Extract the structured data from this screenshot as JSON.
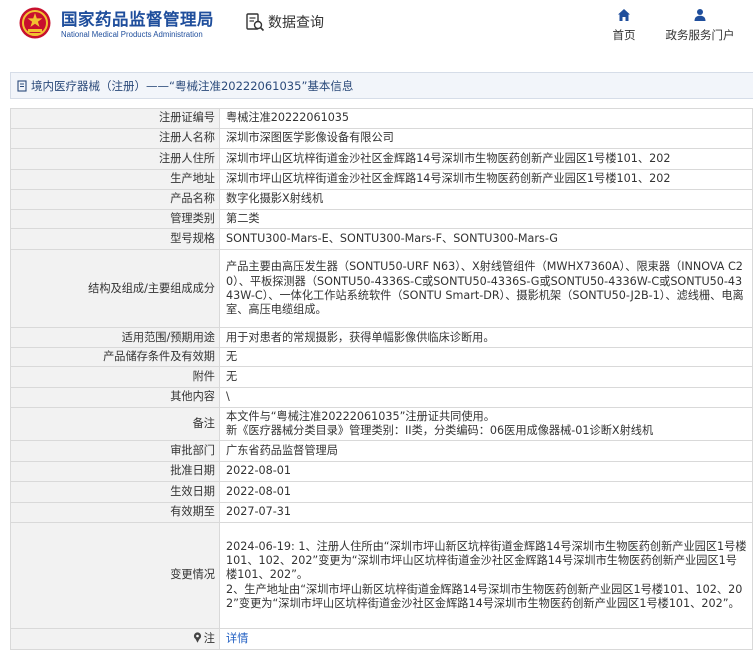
{
  "header": {
    "logo_cn": "国家药品监督管理局",
    "logo_en": "National Medical Products Administration",
    "query_label": "数据查询",
    "nav": {
      "home": "首页",
      "portal": "政务服务门户"
    }
  },
  "title_bar": {
    "text": "境内医疗器械（注册）——“粤械注准20222061035”基本信息"
  },
  "rows": [
    {
      "key": "注册证编号",
      "value": "粤械注准20222061035"
    },
    {
      "key": "注册人名称",
      "value": "深圳市深图医学影像设备有限公司"
    },
    {
      "key": "注册人住所",
      "value": "深圳市坪山区坑梓街道金沙社区金辉路14号深圳市生物医药创新产业园区1号楼101、202"
    },
    {
      "key": "生产地址",
      "value": "深圳市坪山区坑梓街道金沙社区金辉路14号深圳市生物医药创新产业园区1号楼101、202"
    },
    {
      "key": "产品名称",
      "value": "数字化摄影X射线机"
    },
    {
      "key": "管理类别",
      "value": "第二类"
    },
    {
      "key": "型号规格",
      "value": "SONTU300-Mars-E、SONTU300-Mars-F、SONTU300-Mars-G"
    },
    {
      "key": "结构及组成/主要组成成分",
      "value": "产品主要由高压发生器（SONTU50-URF N63）、X射线管组件（MWHX7360A）、限束器（INNOVA C20）、平板探测器（SONTU50-4336S-C或SONTU50-4336S-G或SONTU50-4336W-C或SONTU50-4343W-C）、一体化工作站系统软件（SONTU Smart-DR）、摄影机架（SONTU50-J2B-1）、滤线栅、电离室、高压电缆组成。"
    },
    {
      "key": "适用范围/预期用途",
      "value": "用于对患者的常规摄影，获得单幅影像供临床诊断用。"
    },
    {
      "key": "产品储存条件及有效期",
      "value": "无"
    },
    {
      "key": "附件",
      "value": "无"
    },
    {
      "key": "其他内容",
      "value": "\\"
    },
    {
      "key": "备注",
      "value_lines": [
        "本文件与“粤械注准20222061035”注册证共同使用。",
        "新《医疗器械分类目录》管理类别：II类，分类编码：06医用成像器械-01诊断X射线机"
      ]
    },
    {
      "key": "审批部门",
      "value": "广东省药品监督管理局"
    },
    {
      "key": "批准日期",
      "value": "2022-08-01"
    },
    {
      "key": "生效日期",
      "value": "2022-08-01"
    },
    {
      "key": "有效期至",
      "value": "2027-07-31"
    },
    {
      "key": "变更情况",
      "value_lines": [
        "2024-06-19: 1、注册人住所由“深圳市坪山新区坑梓街道金辉路14号深圳市生物医药创新产业园区1号楼101、102、202”变更为“深圳市坪山区坑梓街道金沙社区金辉路14号深圳市生物医药创新产业园区1号楼101、202”。",
        "2、生产地址由“深圳市坪山新区坑梓街道金辉路14号深圳市生物医药创新产业园区1号楼101、102、202”变更为“深圳市坪山区坑梓街道金沙社区金辉路14号深圳市生物医药创新产业园区1号楼101、202”。"
      ]
    },
    {
      "key": "注",
      "value": "详情",
      "icon": "pin-icon"
    }
  ],
  "colors": {
    "brand": "#1f4e9c",
    "link": "#1f5ec2",
    "key_bg": "#f2f2f2",
    "title_bg": "#f2f5fa"
  }
}
